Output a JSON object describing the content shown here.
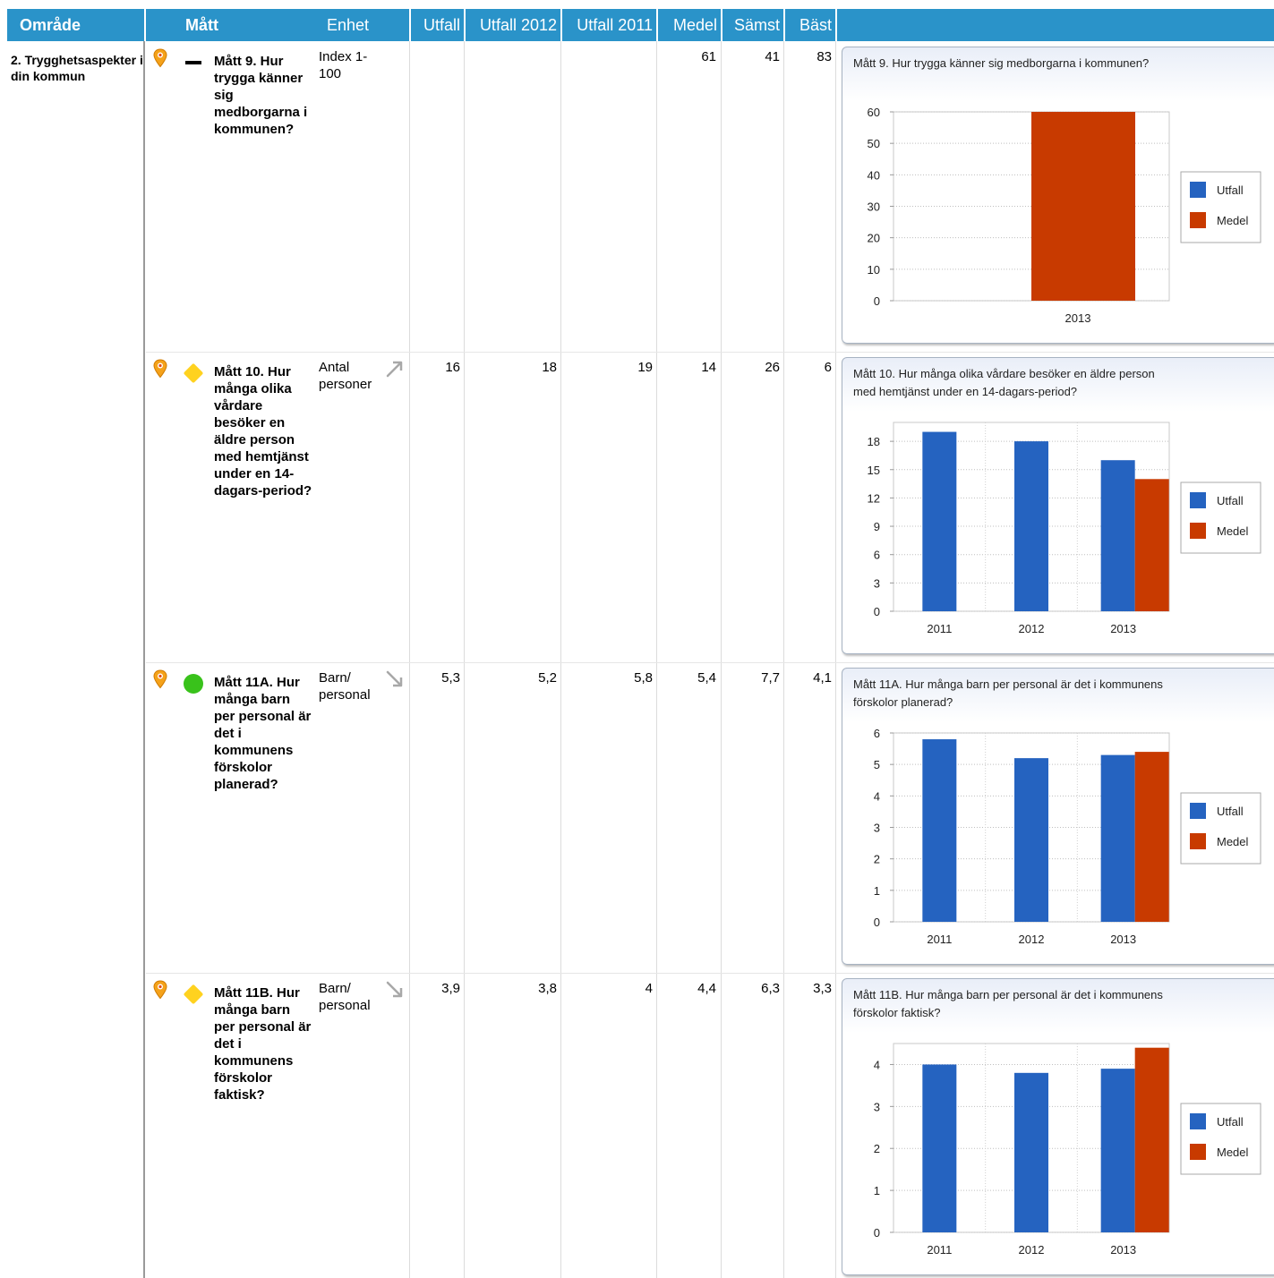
{
  "header": {
    "columns": [
      "Område",
      "Mått",
      "Enhet",
      "Utfall",
      "Utfall 2012",
      "Utfall 2011",
      "Medel",
      "Sämst",
      "Bäst"
    ]
  },
  "area": "2. Trygghetsaspekter i din kommun",
  "legend": {
    "utfall": "Utfall",
    "medel": "Medel"
  },
  "colors": {
    "header": "#2a93c9",
    "utfall": "#2563c0",
    "medel": "#c83a00"
  },
  "rows": [
    {
      "measure": "Mått 9. Hur trygga känner sig medborgarna i kommunen?",
      "unit": "Index 1-100",
      "status": "dash-icon",
      "trend": "",
      "utfall": "",
      "utfall2012": "",
      "utfall2011": "",
      "medel": "61",
      "samst": "41",
      "bast": "83",
      "chart_title": "Mått 9. Hur trygga känner sig medborgarna i kommunen?"
    },
    {
      "measure": "Mått 10. Hur många olika vårdare besöker en äldre person med hemtjänst under en 14-dagars-period?",
      "unit": "Antal personer",
      "status": "yellow-diamond-icon",
      "trend": "arrow-up-right-icon",
      "utfall": "16",
      "utfall2012": "18",
      "utfall2011": "19",
      "medel": "14",
      "samst": "26",
      "bast": "6",
      "chart_title": "Mått 10. Hur många olika vårdare besöker en äldre person med hemtjänst under en 14-dagars-period?"
    },
    {
      "measure": "Mått 11A. Hur många barn per personal är det i kommunens förskolor planerad?",
      "unit": "Barn/ personal",
      "status": "green-circle-icon",
      "trend": "arrow-down-right-icon",
      "utfall": "5,3",
      "utfall2012": "5,2",
      "utfall2011": "5,8",
      "medel": "5,4",
      "samst": "7,7",
      "bast": "4,1",
      "chart_title": "Mått 11A. Hur många barn per personal är det i kommunens förskolor planerad?"
    },
    {
      "measure": "Mått 11B. Hur många barn per personal är det i kommunens förskolor faktisk?",
      "unit": "Barn/ personal",
      "status": "yellow-diamond-icon",
      "trend": "arrow-down-right-icon",
      "utfall": "3,9",
      "utfall2012": "3,8",
      "utfall2011": "4",
      "medel": "4,4",
      "samst": "6,3",
      "bast": "3,3",
      "chart_title": "Mått 11B. Hur många barn per personal är det i kommunens förskolor faktisk?"
    }
  ],
  "chart_data": [
    {
      "type": "bar",
      "title": "Mått 9. Hur trygga känner sig medborgarna i kommunen?",
      "categories": [
        "2013"
      ],
      "series": [
        {
          "name": "Utfall",
          "values": [
            null
          ]
        },
        {
          "name": "Medel",
          "values": [
            61
          ]
        }
      ],
      "ylim": [
        0,
        60
      ],
      "yticks": [
        0,
        10,
        20,
        30,
        40,
        50,
        60
      ],
      "legend": "right",
      "grid": true
    },
    {
      "type": "bar",
      "title": "Mått 10. Hur många olika vårdare besöker en äldre person med hemtjänst under en 14-dagars-period?",
      "categories": [
        "2011",
        "2012",
        "2013"
      ],
      "series": [
        {
          "name": "Utfall",
          "values": [
            19,
            18,
            16
          ]
        },
        {
          "name": "Medel",
          "values": [
            null,
            null,
            14
          ]
        }
      ],
      "ylim": [
        0,
        20
      ],
      "yticks": [
        0,
        3,
        6,
        9,
        12,
        15,
        18
      ],
      "legend": "right",
      "grid": true
    },
    {
      "type": "bar",
      "title": "Mått 11A. Hur många barn per personal är det i kommunens förskolor planerad?",
      "categories": [
        "2011",
        "2012",
        "2013"
      ],
      "series": [
        {
          "name": "Utfall",
          "values": [
            5.8,
            5.2,
            5.3
          ]
        },
        {
          "name": "Medel",
          "values": [
            null,
            null,
            5.4
          ]
        }
      ],
      "ylim": [
        0,
        6
      ],
      "yticks": [
        0,
        1,
        2,
        3,
        4,
        5,
        6
      ],
      "legend": "right",
      "grid": true
    },
    {
      "type": "bar",
      "title": "Mått 11B. Hur många barn per personal är det i kommunens förskolor faktisk?",
      "categories": [
        "2011",
        "2012",
        "2013"
      ],
      "series": [
        {
          "name": "Utfall",
          "values": [
            4,
            3.8,
            3.9
          ]
        },
        {
          "name": "Medel",
          "values": [
            null,
            null,
            4.4
          ]
        }
      ],
      "ylim": [
        0,
        4.5
      ],
      "yticks": [
        0,
        1,
        2,
        3,
        4
      ],
      "legend": "right",
      "grid": true
    }
  ]
}
